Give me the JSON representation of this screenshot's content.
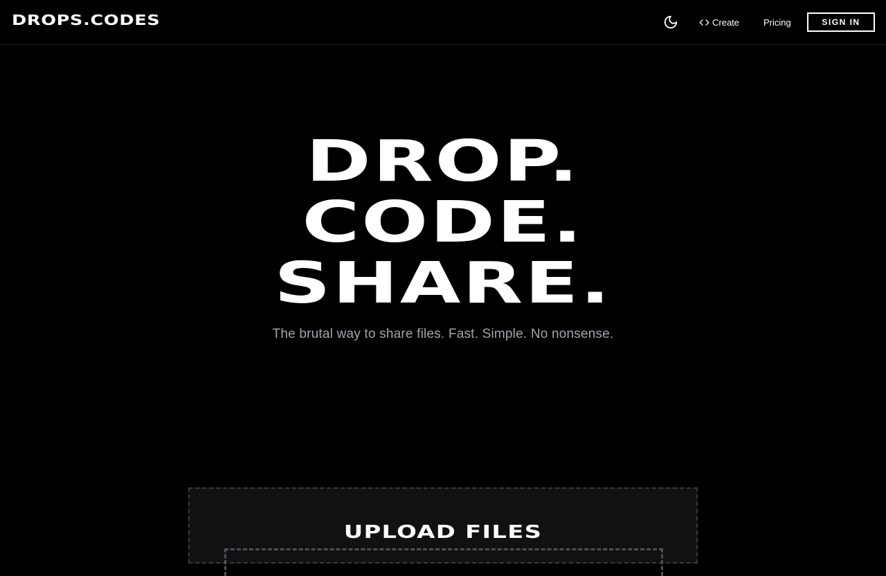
{
  "header": {
    "logo": "DROPS.CODES",
    "theme_icon": "moon-icon",
    "create_icon": "code-icon",
    "create_label": "Create",
    "pricing_label": "Pricing",
    "signin_label": "SIGN IN"
  },
  "hero": {
    "line1": "DROP.",
    "line2": "CODE.",
    "line3": "SHARE.",
    "tagline": "The brutal way to share files. Fast. Simple. No nonsense."
  },
  "upload": {
    "title": "UPLOAD FILES"
  },
  "colors": {
    "background": "#000000",
    "text": "#ffffff",
    "muted": "#a3a3b3",
    "card": "#111111"
  }
}
